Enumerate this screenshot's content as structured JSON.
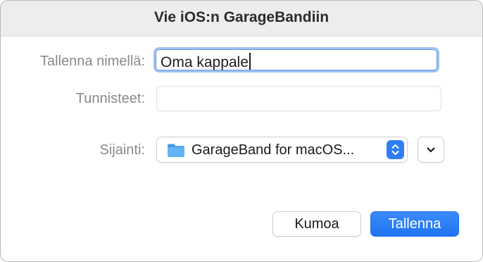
{
  "dialog": {
    "title": "Vie iOS:n GarageBandiin"
  },
  "form": {
    "save_as_label": "Tallenna nimellä:",
    "save_as_value": "Oma kappale",
    "tags_label": "Tunnisteet:",
    "tags_value": "",
    "location_label": "Sijainti:",
    "location_value": "GarageBand for macOS..."
  },
  "buttons": {
    "cancel_label": "Kumoa",
    "save_label": "Tallenna"
  },
  "icons": {
    "folder": "folder-icon",
    "stepper": "up-down-chevron-icon",
    "expand": "chevron-down-icon"
  },
  "colors": {
    "accent": "#2f7ef6",
    "focus_ring": "#9ec0f3",
    "folder": "#5aaef0"
  }
}
